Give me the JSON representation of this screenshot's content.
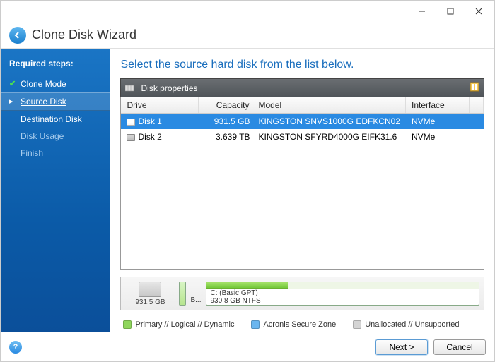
{
  "window": {
    "title": "Clone Disk Wizard"
  },
  "sidebar": {
    "heading": "Required steps:",
    "steps": [
      {
        "label": "Clone Mode",
        "state": "completed"
      },
      {
        "label": "Source Disk",
        "state": "current"
      },
      {
        "label": "Destination Disk",
        "state": "upcoming"
      },
      {
        "label": "Disk Usage",
        "state": "disabled"
      },
      {
        "label": "Finish",
        "state": "disabled"
      }
    ]
  },
  "main": {
    "title": "Select the source hard disk from the list below.",
    "panel_title": "Disk properties",
    "columns": {
      "drive": "Drive",
      "capacity": "Capacity",
      "model": "Model",
      "interface": "Interface"
    },
    "disks": [
      {
        "drive": "Disk 1",
        "capacity": "931.5 GB",
        "model": "KINGSTON SNVS1000G EDFKCN02",
        "interface": "NVMe",
        "selected": true
      },
      {
        "drive": "Disk 2",
        "capacity": "3.639 TB",
        "model": "KINGSTON SFYRD4000G EIFK31.6",
        "interface": "NVMe",
        "selected": false
      }
    ],
    "layout": {
      "disk_size": "931.5 GB",
      "sm_label": "B...",
      "partition_name": "C: (Basic GPT)",
      "partition_size": "930.8 GB  NTFS"
    },
    "legend": {
      "primary": "Primary // Logical // Dynamic",
      "securezone": "Acronis Secure Zone",
      "unallocated": "Unallocated // Unsupported"
    }
  },
  "footer": {
    "next": "Next >",
    "cancel": "Cancel"
  }
}
